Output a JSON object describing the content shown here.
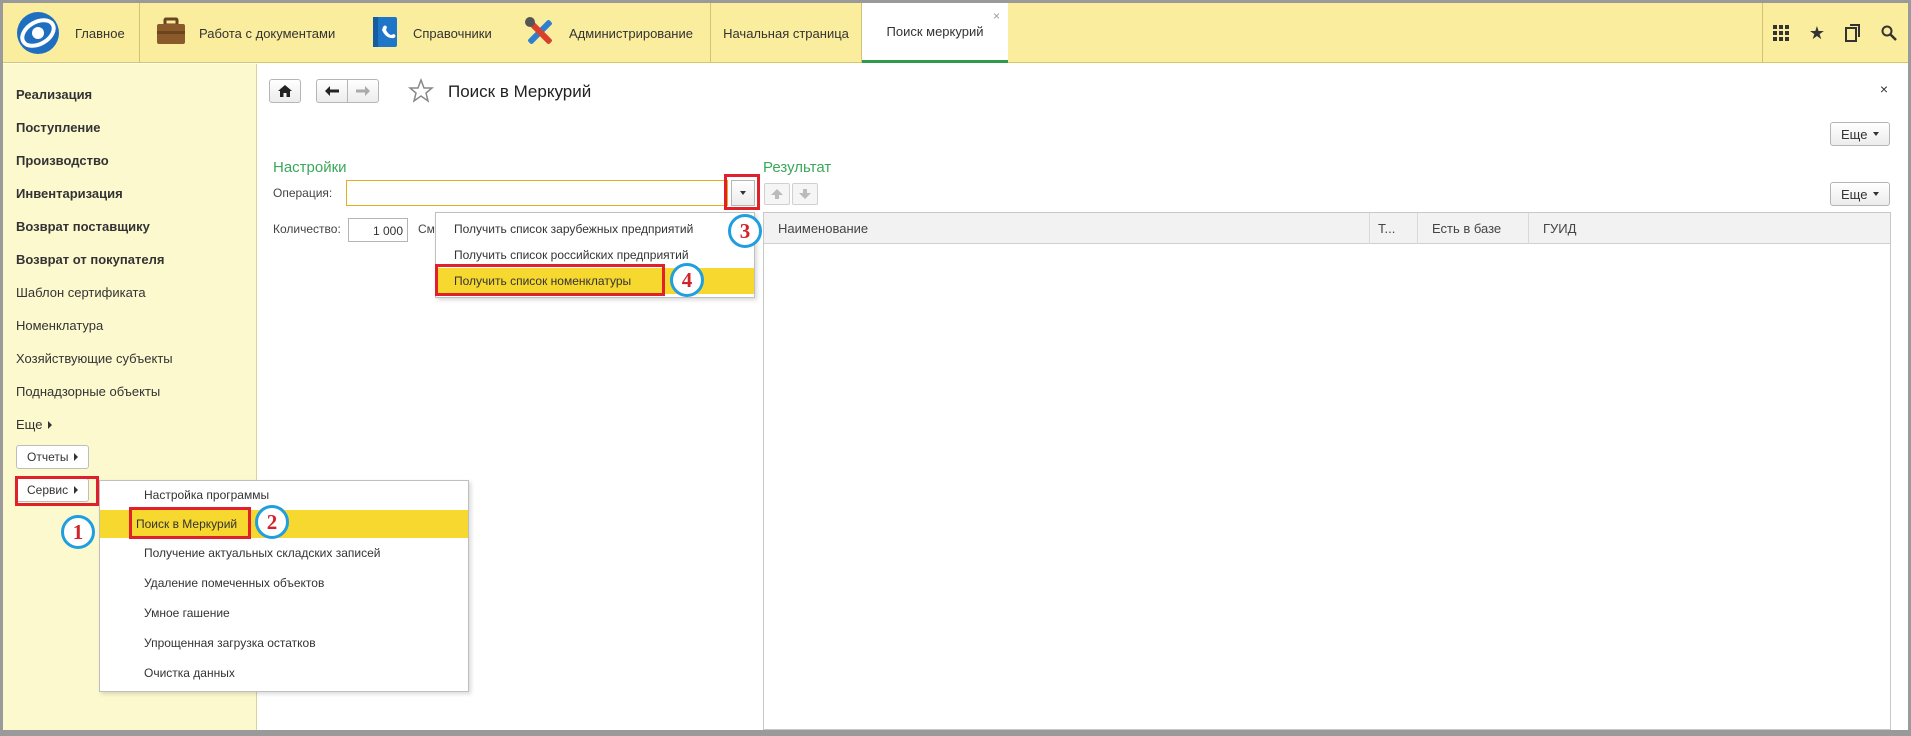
{
  "topbar": {
    "sections": [
      {
        "label": "Главное",
        "icon": "logo-icon"
      },
      {
        "label": "Работа с документами",
        "icon": "briefcase-icon"
      },
      {
        "label": "Справочники",
        "icon": "phonebook-icon"
      },
      {
        "label": "Администрирование",
        "icon": "tools-icon"
      }
    ],
    "tabs": [
      {
        "label": "Начальная страница"
      },
      {
        "label": "Поиск меркурий",
        "close": "×"
      }
    ],
    "icons": {
      "grid": "▦",
      "star": "★",
      "history": "⧉",
      "search": "🔍"
    }
  },
  "sidebar": {
    "items": [
      {
        "label": "Реализация"
      },
      {
        "label": "Поступление"
      },
      {
        "label": "Производство"
      },
      {
        "label": "Инвентаризация"
      },
      {
        "label": "Возврат поставщику"
      },
      {
        "label": "Возврат от покупателя"
      },
      {
        "label": "Шаблон сертификата"
      },
      {
        "label": "Номенклатура"
      },
      {
        "label": "Хозяйствующие субъекты"
      },
      {
        "label": "Поднадзорные объекты"
      },
      {
        "label": "Еще"
      }
    ],
    "reports_button": "Отчеты",
    "service_button": "Сервис"
  },
  "service_menu": {
    "items": [
      {
        "label": "Настройка программы"
      },
      {
        "label": "Поиск в Меркурий"
      },
      {
        "label": "Получение актуальных складских записей"
      },
      {
        "label": "Удаление помеченных объектов"
      },
      {
        "label": "Умное гашение"
      },
      {
        "label": "Упрощенная загрузка остатков"
      },
      {
        "label": "Очистка данных"
      }
    ],
    "selected_index": 1
  },
  "form": {
    "title": "Поиск в Меркурий",
    "more_label": "Еще",
    "close": "×",
    "settings_title": "Настройки",
    "operation_label": "Операция:",
    "operation_value": "",
    "quantity_label": "Количество:",
    "quantity_value": "1 000",
    "offset_label_partial": "См",
    "result_title": "Результат",
    "result_more_label": "Еще"
  },
  "operation_options": {
    "items": [
      {
        "label": "Получить список зарубежных предприятий"
      },
      {
        "label": "Получить список российских предприятий"
      },
      {
        "label": "Получить список номенклатуры"
      }
    ],
    "selected_index": 2
  },
  "result_table": {
    "columns": [
      "Наименование",
      "Т...",
      "Есть в базе",
      "ГУИД"
    ],
    "rows": []
  },
  "annotations": {
    "markers": [
      "1",
      "2",
      "3",
      "4"
    ]
  },
  "colors": {
    "topbar_bg": "#fbed9e",
    "sidebar_bg": "#fdf9cf",
    "accent_green": "#3aa85a",
    "highlight_yellow": "#f7d82f",
    "annotation_red": "#e0202a",
    "annotation_blue": "#1f9ee0"
  }
}
